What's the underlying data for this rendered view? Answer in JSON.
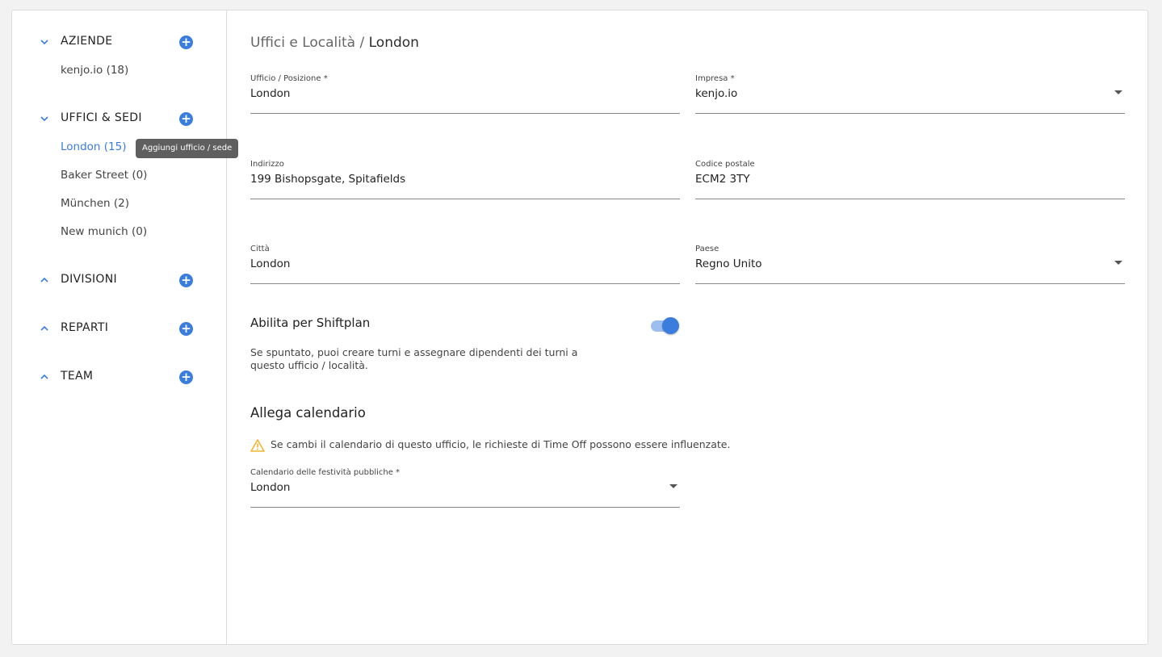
{
  "sidebar": {
    "sections": [
      {
        "title": "AZIENDE",
        "expanded": true,
        "items": [
          {
            "label": "kenjo.io (18)"
          }
        ]
      },
      {
        "title": "UFFICI & SEDI",
        "expanded": true,
        "items": [
          {
            "label": "London (15)",
            "active": true
          },
          {
            "label": "Baker Street (0)"
          },
          {
            "label": "München (2)"
          },
          {
            "label": "New munich (0)"
          }
        ]
      },
      {
        "title": "DIVISIONI",
        "expanded": false,
        "items": []
      },
      {
        "title": "REPARTI",
        "expanded": false,
        "items": []
      },
      {
        "title": "TEAM",
        "expanded": false,
        "items": []
      }
    ],
    "tooltip": "Aggiungi ufficio / sede"
  },
  "breadcrumb": {
    "parent": "Uffici e Località / ",
    "current": "London"
  },
  "form": {
    "office": {
      "label": "Ufficio / Posizione *",
      "value": "London"
    },
    "company": {
      "label": "Impresa *",
      "value": "kenjo.io"
    },
    "address": {
      "label": "Indirizzo",
      "value": "199 Bishopsgate, Spitafields"
    },
    "postal": {
      "label": "Codice postale",
      "value": "ECM2 3TY"
    },
    "city": {
      "label": "Città",
      "value": "London"
    },
    "country": {
      "label": "Paese",
      "value": "Regno Unito"
    }
  },
  "shiftplan": {
    "label": "Abilita per Shiftplan",
    "enabled": true,
    "help": "Se spuntato, puoi creare turni e assegnare dipendenti dei turni a questo ufficio / località."
  },
  "calendar": {
    "title": "Allega calendario",
    "warning": "Se cambi il calendario di questo ufficio, le richieste di Time Off possono essere influenzate.",
    "field_label": "Calendario delle festività pubbliche *",
    "value": "London"
  },
  "colors": {
    "accent": "#3b7ddd",
    "warning": "#f2b531"
  }
}
